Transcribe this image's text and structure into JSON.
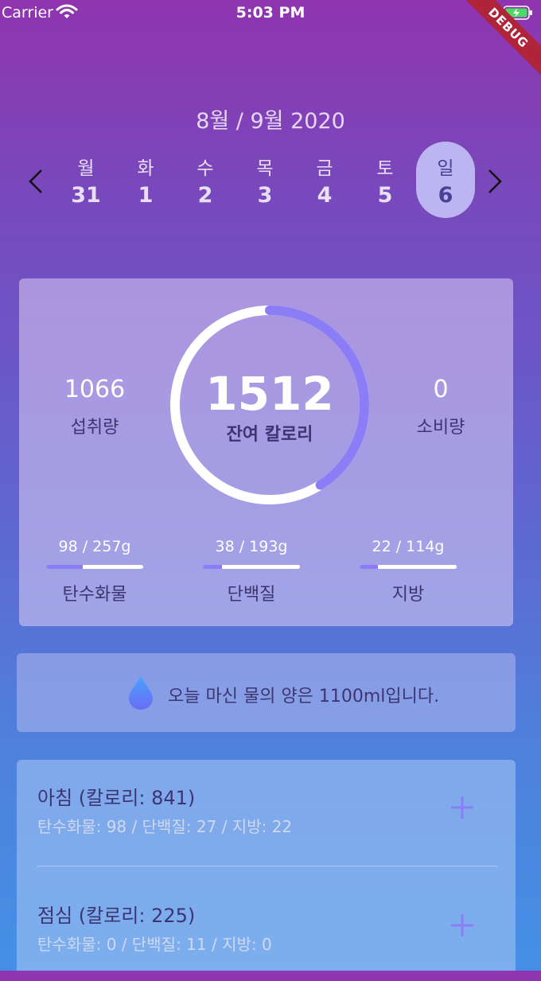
{
  "status_bar": {
    "carrier": "Carrier",
    "time": "5:03 PM",
    "debug": "DEBUG"
  },
  "header": {
    "month_title": "8월  / 9월 2020",
    "days": [
      {
        "name": "월",
        "num": "31"
      },
      {
        "name": "화",
        "num": "1"
      },
      {
        "name": "수",
        "num": "2"
      },
      {
        "name": "목",
        "num": "3"
      },
      {
        "name": "금",
        "num": "4"
      },
      {
        "name": "토",
        "num": "5"
      },
      {
        "name": "일",
        "num": "6"
      }
    ],
    "selected_index": 6
  },
  "summary": {
    "intake_value": "1066",
    "intake_label": "섭취량",
    "remaining_value": "1512",
    "remaining_label": "잔여 칼로리",
    "burned_value": "0",
    "burned_label": "소비량",
    "ring_progress": 0.41,
    "macros": [
      {
        "value": "98 / 257g",
        "label": "탄수화물",
        "fraction": 0.38
      },
      {
        "value": "38 / 193g",
        "label": "단백질",
        "fraction": 0.2
      },
      {
        "value": "22 / 114g",
        "label": "지방",
        "fraction": 0.19
      }
    ]
  },
  "water": {
    "text": "오늘 마신 물의 양은 1100ml입니다."
  },
  "meals": [
    {
      "title": "아침 (칼로리: 841)",
      "detail": "탄수화물: 98 / 단백질: 27 / 지방: 22"
    },
    {
      "title": "점심 (칼로리: 225)",
      "detail": "탄수화물: 0 / 단백질: 11 / 지방: 0"
    }
  ],
  "colors": {
    "accent": "#8b7df5",
    "ring_track": "#ffffff",
    "dark_text": "#3d3570"
  }
}
